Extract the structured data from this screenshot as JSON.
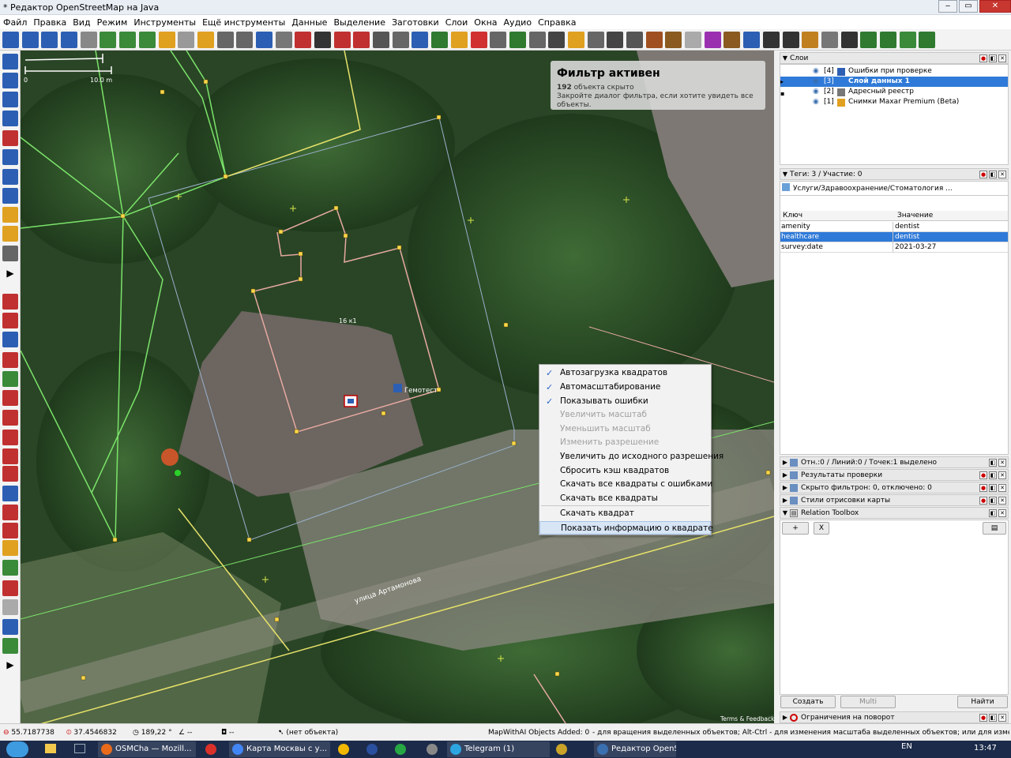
{
  "window": {
    "title": "* Редактор OpenStreetMap на Java",
    "btn_min": "‒",
    "btn_max": "▭",
    "btn_close": "✕"
  },
  "menu": [
    "Файл",
    "Правка",
    "Вид",
    "Режим",
    "Инструменты",
    "Ещё инструменты",
    "Данные",
    "Выделение",
    "Заготовки",
    "Слои",
    "Окна",
    "Аудио",
    "Справка"
  ],
  "map": {
    "scale_zero": "0",
    "scale_label": "10.0 m",
    "building_label": "16 к1",
    "poi_label": "Гемотест",
    "street_label": "улица Артамонова",
    "attribution": "Terms & Feedback"
  },
  "filter_overlay": {
    "title": "Фильтр активен",
    "hidden_count": "192",
    "hidden_text": " объекта скрыто",
    "hint": "Закройте диалог фильтра, если хотите увидеть все объекты."
  },
  "context_menu": [
    {
      "label": "Автозагрузка квадратов",
      "checked": true,
      "disabled": false
    },
    {
      "label": "Автомасштабирование",
      "checked": true,
      "disabled": false
    },
    {
      "label": "Показывать ошибки",
      "checked": true,
      "disabled": false
    },
    {
      "label": "Увеличить масштаб",
      "checked": false,
      "disabled": true
    },
    {
      "label": "Уменьшить масштаб",
      "checked": false,
      "disabled": true
    },
    {
      "label": "Изменить разрешение",
      "checked": false,
      "disabled": true
    },
    {
      "label": "Увеличить до исходного разрешения",
      "checked": false,
      "disabled": false
    },
    {
      "label": "Сбросить кэш квадратов",
      "checked": false,
      "disabled": false
    },
    {
      "label": "Скачать все квадраты с ошибками",
      "checked": false,
      "disabled": false
    },
    {
      "label": "Скачать все квадраты",
      "checked": false,
      "disabled": false
    },
    {
      "label": "Скачать квадрат",
      "checked": false,
      "disabled": false
    },
    {
      "label": "Показать информацию о квадрате",
      "checked": false,
      "disabled": false,
      "highlighted": true
    }
  ],
  "context_menu_check": "✓",
  "layers_panel": {
    "title": "Слои",
    "layers": [
      {
        "num": "[4]",
        "name": "Ошибки при проверке",
        "selected": false
      },
      {
        "num": "[3]",
        "name": "Слой данных 1",
        "selected": true
      },
      {
        "num": "[2]",
        "name": "Адресный реестр",
        "selected": false
      },
      {
        "num": "[1]",
        "name": "Снимки Maxar Premium (Beta)",
        "selected": false
      }
    ]
  },
  "tags_panel": {
    "title": "Теги: 3 / Участие: 0",
    "preset": "Услуги/Здравоохранение/Стоматология ...",
    "col_key": "Ключ",
    "col_value": "Значение",
    "rows": [
      {
        "key": "amenity",
        "value": "dentist",
        "selected": false
      },
      {
        "key": "healthcare",
        "value": "dentist",
        "selected": true
      },
      {
        "key": "survey:date",
        "value": "2021-03-27",
        "selected": false
      }
    ]
  },
  "collapsed_panels": [
    {
      "title": "Отн.:0 / Линий:0 / Точек:1 выделено"
    },
    {
      "title": "Результаты проверки"
    },
    {
      "title": "Скрыто фильтрон: 0, отключено: 0"
    },
    {
      "title": "Стили отрисовки карты"
    }
  ],
  "relation_toolbox": {
    "title": "Relation Toolbox",
    "btn_add": "+",
    "btn_clear": "X"
  },
  "bottom_buttons": {
    "create": "Создать",
    "multi": "Multi",
    "find": "Найти"
  },
  "turn_restrictions": {
    "title": "Ограничения на поворот"
  },
  "status": {
    "lat": "55.7187738",
    "lon": "37.4546832",
    "heading": "189,22 °",
    "angle": "--",
    "distance": "--",
    "object": "(нет объекта)",
    "mapwithai": "MapWithAI Objects Added: 0",
    "hint": "- для вращения выделенных объектов; Alt-Ctrl - для изменения масштаба выделенных объектов; или для изменения выделения"
  },
  "taskbar": {
    "tasks": [
      {
        "label": "OSMCha — Mozill...",
        "color": "#e86a1a"
      },
      {
        "label": "",
        "color": "#d8312a"
      },
      {
        "label": "Карта Москвы с у...",
        "color": "#4285f4"
      },
      {
        "label": "",
        "color": "#f2b700"
      },
      {
        "label": "",
        "color": "#2a4f9e"
      },
      {
        "label": "",
        "color": "#27a744"
      },
      {
        "label": "",
        "color": "#888888"
      },
      {
        "label": "Telegram (1)",
        "color": "#2ca5e0"
      },
      {
        "label": "",
        "color": "#c9a227"
      },
      {
        "label": "Редактор OpenSt...",
        "color": "#3a6fb0"
      }
    ],
    "lang": "EN",
    "time": "13:47"
  },
  "colors": {
    "accent": "#2f7ad8",
    "map_green": "#7be36a",
    "map_yellow": "#e8e36a"
  }
}
